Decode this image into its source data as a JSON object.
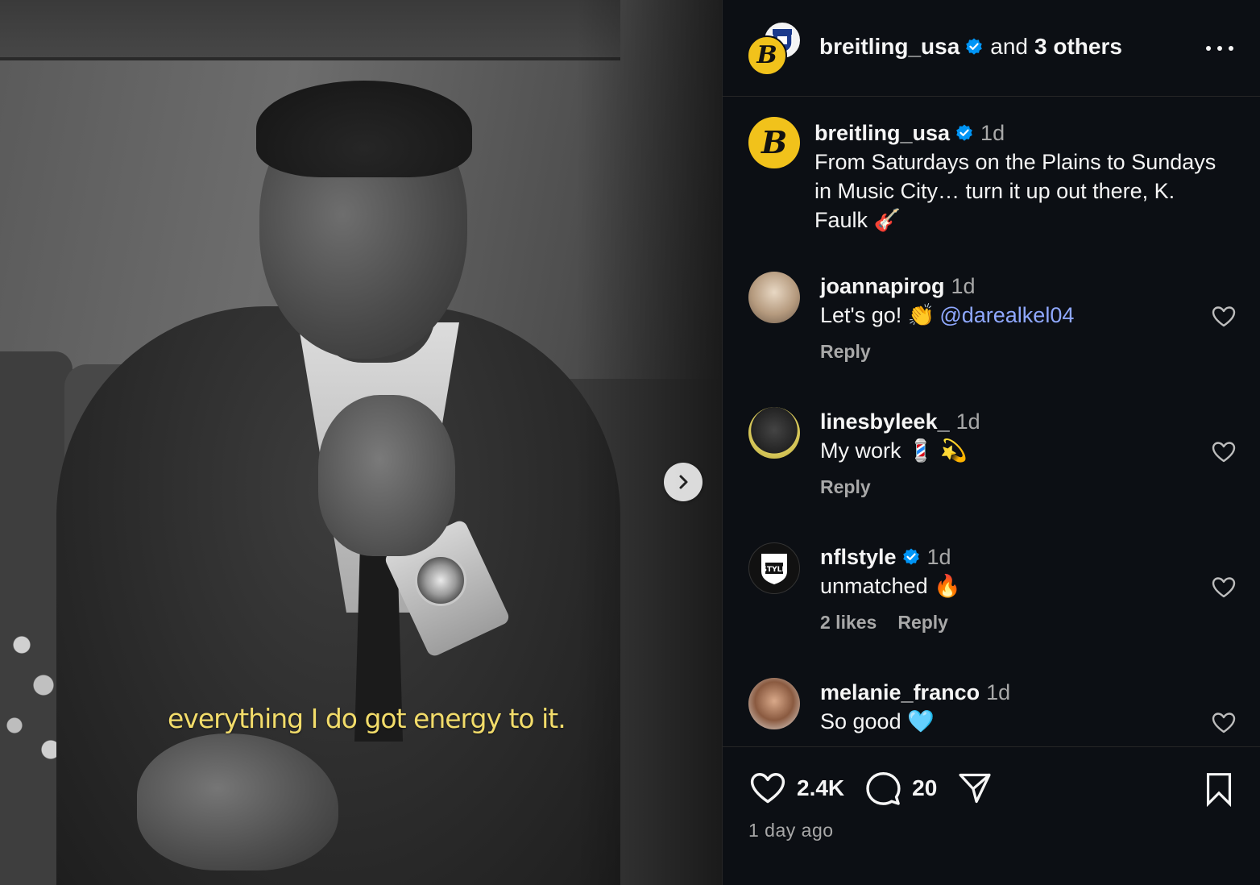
{
  "media": {
    "caption_overlay": "everything I do got energy to it.",
    "next_icon": "chevron-right-icon"
  },
  "header": {
    "username": "breitling_usa",
    "and_text": "and",
    "others_text": "3 others",
    "more_icon": "more-horizontal-icon",
    "verified_color": "#0095f6"
  },
  "post_caption": {
    "username": "breitling_usa",
    "time": "1d",
    "text": "From Saturdays on the Plains to Sundays in Music City… turn it up out there, K. Faulk 🎸"
  },
  "comments": [
    {
      "username": "joannapirog",
      "time": "1d",
      "text": "Let's go! 👏",
      "mention": "@darealkel04",
      "likes": "",
      "reply": "Reply",
      "verified": false
    },
    {
      "username": "linesbyleek_",
      "time": "1d",
      "text": "My work 💈 💫",
      "mention": "",
      "likes": "",
      "reply": "Reply",
      "verified": false
    },
    {
      "username": "nflstyle",
      "time": "1d",
      "text": "unmatched 🔥",
      "mention": "",
      "likes": "2 likes",
      "reply": "Reply",
      "verified": true
    },
    {
      "username": "melanie_franco",
      "time": "1d",
      "text": "So good 🩵",
      "mention": "",
      "likes": "",
      "reply": "",
      "verified": false
    }
  ],
  "footer": {
    "likes_count": "2.4K",
    "comments_count": "20",
    "timestamp": "1 day ago"
  },
  "colors": {
    "brand_yellow": "#f1c21b",
    "mention_blue": "#8fa8ff",
    "caption_yellow": "#f2dc6a",
    "background": "#0c0f14"
  }
}
